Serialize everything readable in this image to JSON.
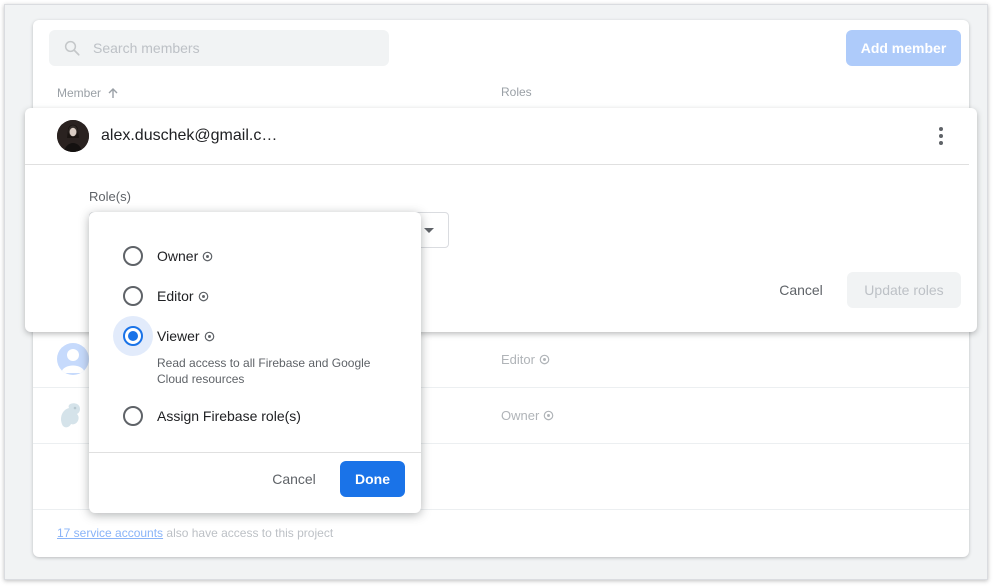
{
  "search": {
    "placeholder": "Search members",
    "icon": "search-icon"
  },
  "toolbar": {
    "add_member_label": "Add member"
  },
  "table": {
    "columns": {
      "member": "Member",
      "roles": "Roles"
    },
    "rows": [
      {
        "role": "Editor"
      },
      {
        "role": "Owner"
      }
    ]
  },
  "footer": {
    "link": "17 service accounts",
    "text": " also have access to this project"
  },
  "edit_panel": {
    "email": "alex.duschek@gmail.c…",
    "roles_label": "Role(s)",
    "cancel_label": "Cancel",
    "update_label": "Update roles"
  },
  "role_dropdown": {
    "options": [
      {
        "label": "Owner",
        "selected": false
      },
      {
        "label": "Editor",
        "selected": false
      },
      {
        "label": "Viewer",
        "selected": true,
        "description": "Read access to all Firebase and Google Cloud resources"
      },
      {
        "label": "Assign Firebase role(s)",
        "selected": false
      }
    ],
    "cancel_label": "Cancel",
    "done_label": "Done"
  },
  "colors": {
    "accent": "#1a73e8",
    "accent_disabled": "#aecbfa",
    "link": "#8ab4f8"
  }
}
